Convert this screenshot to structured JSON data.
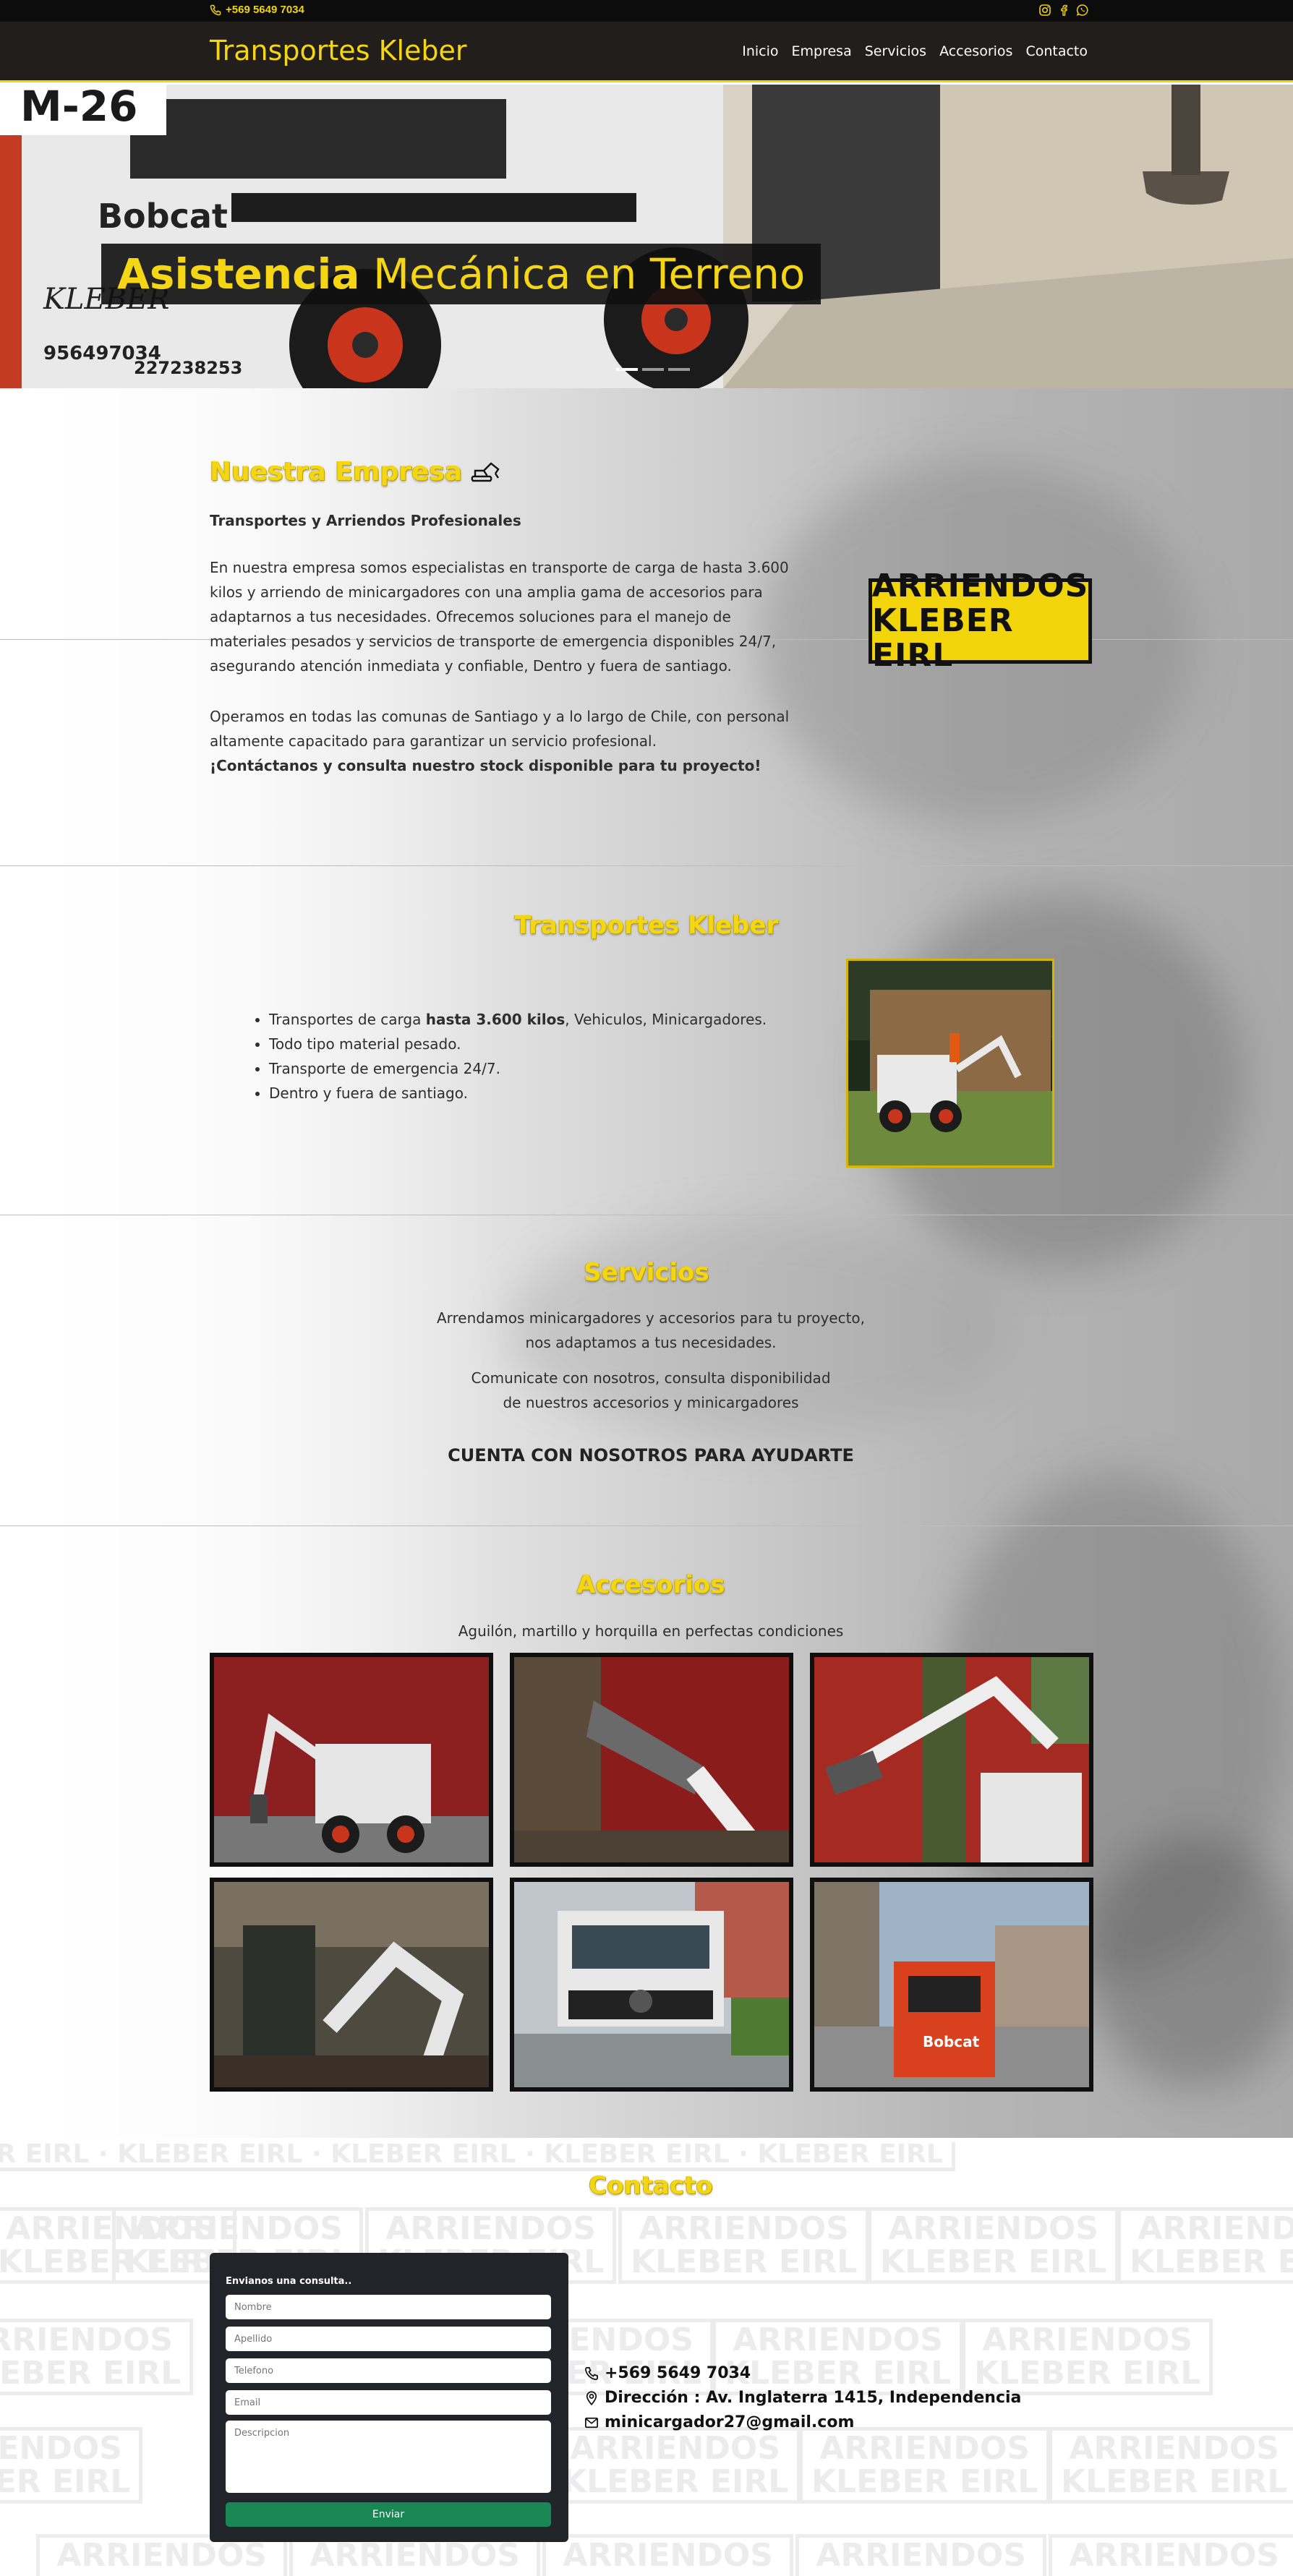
{
  "topbar": {
    "phone": "+569 5649 7034",
    "social_icons": [
      "instagram-icon",
      "facebook-icon",
      "whatsapp-icon"
    ]
  },
  "nav": {
    "brand": "Transportes Kleber",
    "items": [
      "Inicio",
      "Empresa",
      "Servicios",
      "Accesorios",
      "Contacto"
    ]
  },
  "hero": {
    "caption_bold": "Asistencia",
    "caption_rest": " Mecánica en Terreno",
    "slides": 3,
    "active_slide": 1
  },
  "empresa": {
    "title": "Nuestra Empresa",
    "subtitle": "Transportes y Arriendos Profesionales",
    "p1_lines": [
      "En nuestra empresa somos especialistas en transporte de carga de hasta 3.600",
      "kilos y arriendo de minicargadores con una amplia gama de accesorios para",
      "adaptarnos a tus necesidades. Ofrecemos soluciones para el manejo de",
      "materiales pesados y servicios de transporte de emergencia disponibles 24/7,",
      "asegurando atención inmediata y confiable, Dentro y fuera de santiago."
    ],
    "p2_lines": [
      "Operamos en todas las comunas de Santiago y a lo largo de Chile, con personal",
      "altamente capacitado para garantizar un servicio profesional."
    ],
    "cta": "¡Contáctanos y consulta nuestro stock disponible para tu proyecto!",
    "logo_line1": "ARRIENDOS",
    "logo_line2": "KLEBER EIRL"
  },
  "transportes": {
    "title": "Transportes Kleber",
    "item1_pre": "Transportes de carga ",
    "item1_bold": "hasta 3.600 kilos",
    "item1_post": ", Vehiculos, Minicargadores.",
    "item2": "Todo tipo material pesado.",
    "item3": "Transporte de emergencia 24/7.",
    "item4": "Dentro y fuera de santiago."
  },
  "servicios": {
    "title": "Servicios",
    "line1": "Arrendamos minicargadores y accesorios para tu proyecto,",
    "line2": "nos adaptamos a tus necesidades.",
    "line3": "Comunicate con nosotros, consulta disponibilidad",
    "line4": "de nuestros accesorios y minicargadores",
    "tagline": "CUENTA CON NOSOTROS PARA AYUDARTE"
  },
  "accesorios": {
    "title": "Accesorios",
    "subtitle": "Aguilón, martillo y horquilla en perfectas condiciones"
  },
  "contacto": {
    "title": "Contacto",
    "form_title": "Envianos una consulta..",
    "placeholders": {
      "nombre": "Nombre",
      "apellido": "Apellido",
      "telefono": "Telefono",
      "email": "Email",
      "descripcion": "Descripcion"
    },
    "send_label": "Enviar",
    "phone": "+569 5649 7034",
    "address": "Dirección : Av. Inglaterra 1415, Independencia",
    "email": "minicargador27@gmail.com"
  },
  "colors": {
    "brand_yellow": "#f4d615",
    "nav_bg": "#221e1c",
    "topbar_bg": "#0c0c0c",
    "send_green": "#198754",
    "form_bg": "#212529"
  }
}
